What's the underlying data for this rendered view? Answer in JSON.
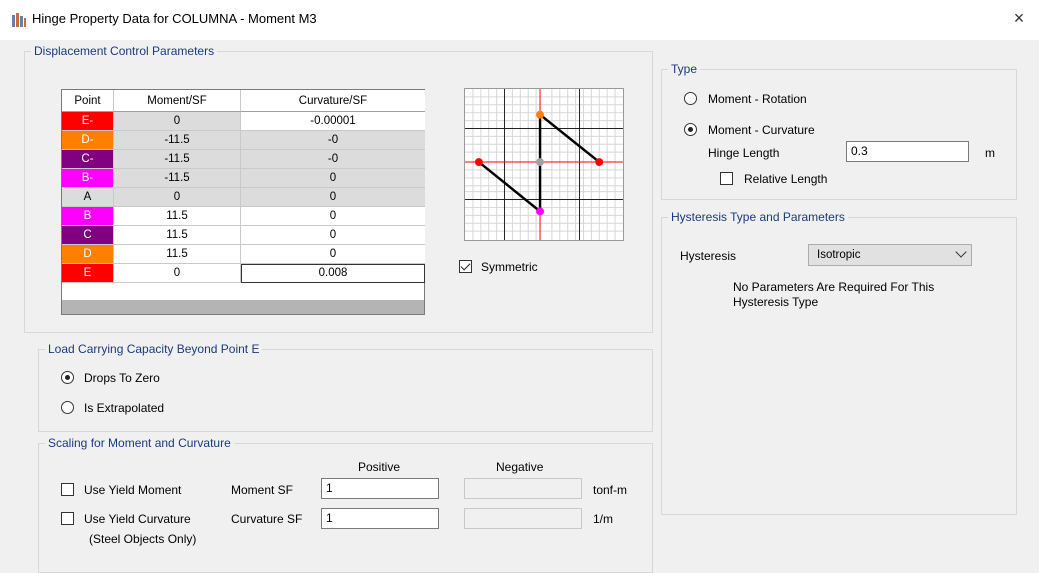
{
  "window": {
    "title": "Hinge Property Data for COLUMNA - Moment M3",
    "close": "×"
  },
  "displacement": {
    "title": "Displacement Control Parameters",
    "columns": [
      "Point",
      "Moment/SF",
      "Curvature/SF"
    ],
    "rows": [
      {
        "point": "E-",
        "moment": "0",
        "curvature": "-0.00001",
        "color": "#ff0000"
      },
      {
        "point": "D-",
        "moment": "-11.5",
        "curvature": "-0",
        "color": "#ff8000"
      },
      {
        "point": "C-",
        "moment": "-11.5",
        "curvature": "-0",
        "color": "#800080"
      },
      {
        "point": "B-",
        "moment": "-11.5",
        "curvature": "0",
        "color": "#ff00ff"
      },
      {
        "point": "A",
        "moment": "0",
        "curvature": "0",
        "color": "#dcdcdc"
      },
      {
        "point": "B",
        "moment": "11.5",
        "curvature": "0",
        "color": "#ff00ff"
      },
      {
        "point": "C",
        "moment": "11.5",
        "curvature": "0",
        "color": "#800080"
      },
      {
        "point": "D",
        "moment": "11.5",
        "curvature": "0",
        "color": "#ff8000"
      },
      {
        "point": "E",
        "moment": "0",
        "curvature": "0.008",
        "color": "#ff0000"
      }
    ],
    "symmetric_label": "Symmetric",
    "symmetric_checked": true
  },
  "load_capacity": {
    "title": "Load Carrying Capacity Beyond Point E",
    "drops_to_zero": "Drops To Zero",
    "is_extrapolated": "Is Extrapolated",
    "selected": "drops_to_zero"
  },
  "scaling": {
    "title": "Scaling for Moment and Curvature",
    "positive_header": "Positive",
    "negative_header": "Negative",
    "use_yield_moment": "Use Yield Moment",
    "use_yield_curvature": "Use Yield Curvature",
    "steel_note": "(Steel Objects Only)",
    "moment_sf_label": "Moment SF",
    "curvature_sf_label": "Curvature SF",
    "moment_sf_positive": "1",
    "curvature_sf_positive": "1",
    "moment_unit": "tonf-m",
    "curvature_unit": "1/m"
  },
  "type": {
    "title": "Type",
    "moment_rotation": "Moment - Rotation",
    "moment_curvature": "Moment - Curvature",
    "selected": "moment_curvature",
    "hinge_length_label": "Hinge Length",
    "hinge_length_value": "0.3",
    "hinge_length_unit": "m",
    "relative_length": "Relative Length"
  },
  "hysteresis": {
    "title": "Hysteresis Type and Parameters",
    "label": "Hysteresis",
    "selected": "Isotropic",
    "note_line1": "No Parameters Are Required For This",
    "note_line2": "Hysteresis Type"
  }
}
